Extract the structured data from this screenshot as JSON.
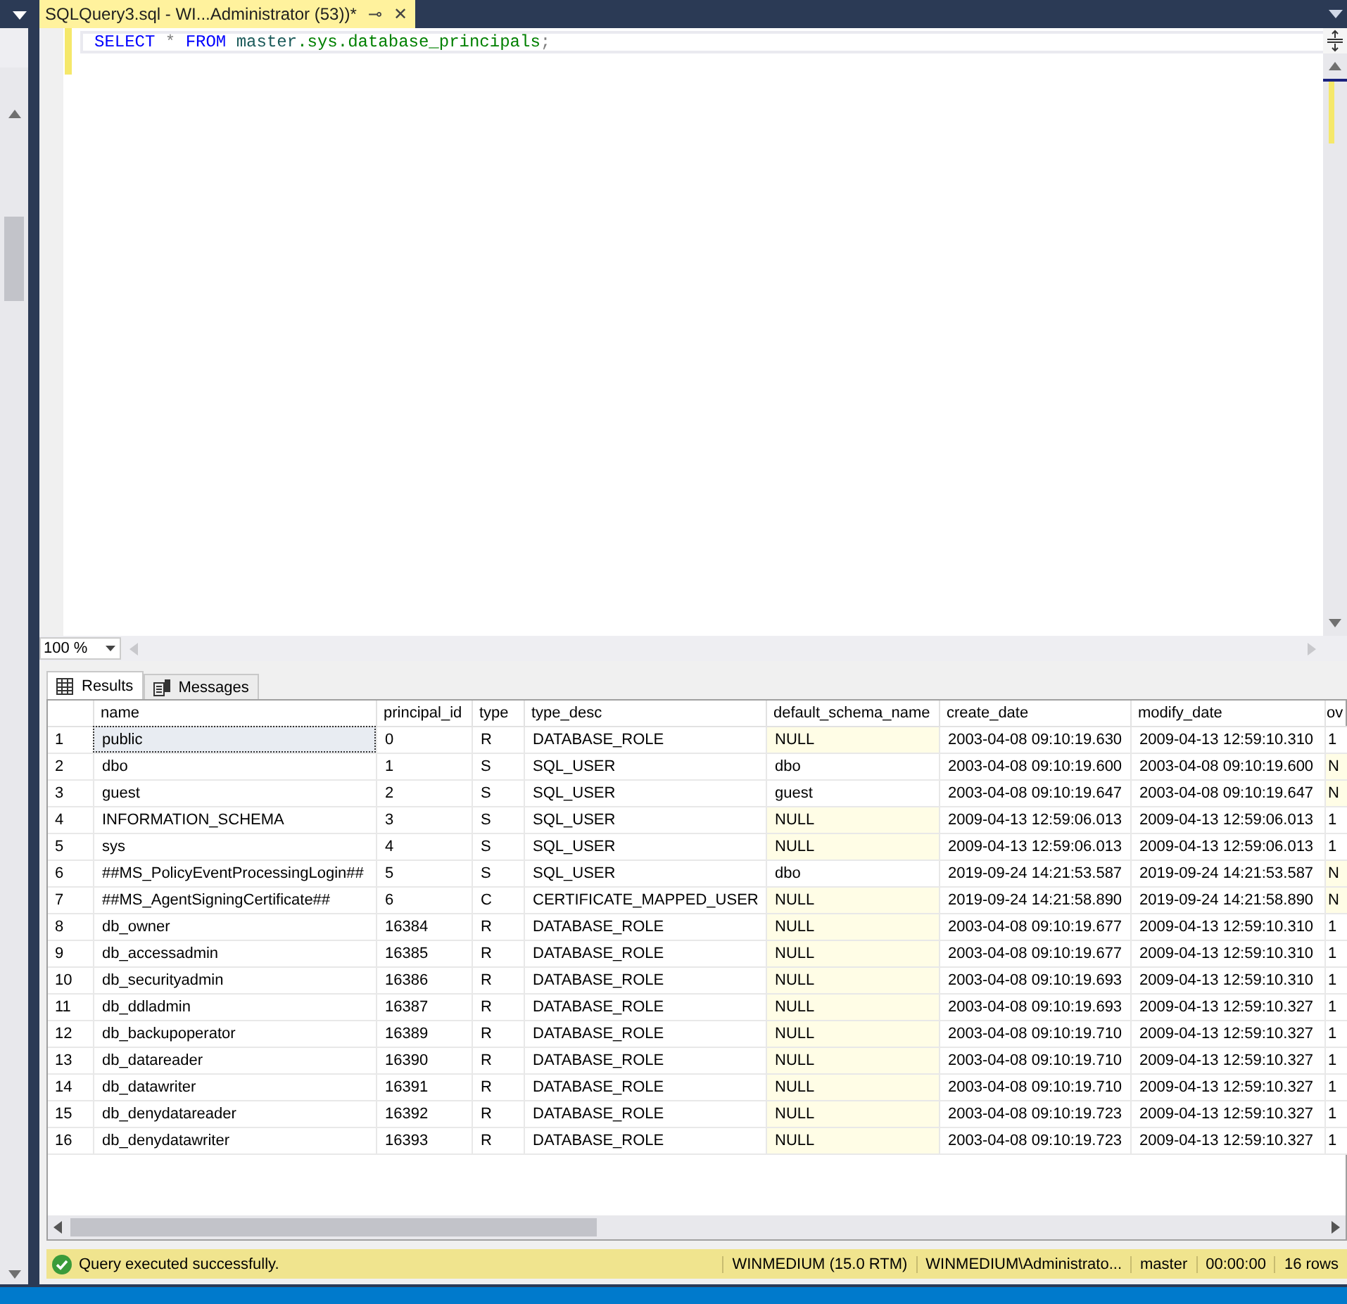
{
  "document_tab": {
    "title": "SQLQuery3.sql - WI...Administrator (53))*",
    "pin": "⊸",
    "close": "✕"
  },
  "editor": {
    "lines": [
      [
        {
          "kind": "keyword",
          "text": "SELECT"
        },
        {
          "kind": "operator",
          "text": "*"
        },
        {
          "kind": "keyword",
          "text": "FROM"
        },
        {
          "kind": "identifier",
          "text": "master"
        },
        {
          "kind": "system",
          "text": ".sys.database_principals"
        },
        {
          "kind": "operator",
          "text": ";"
        }
      ]
    ]
  },
  "zoom": {
    "value": "100 %"
  },
  "result_tabs": [
    {
      "label": "Results",
      "kind": "grid",
      "selected": true
    },
    {
      "label": "Messages",
      "kind": "messages",
      "selected": false
    }
  ],
  "grid": {
    "columns": [
      "name",
      "principal_id",
      "type",
      "type_desc",
      "default_schema_name",
      "create_date",
      "modify_date",
      "ov"
    ],
    "rows": [
      {
        "number": "1",
        "selected": true,
        "cells": [
          {
            "text": "public",
            "null": false
          },
          {
            "text": "0",
            "null": false
          },
          {
            "text": "R",
            "null": false
          },
          {
            "text": "DATABASE_ROLE",
            "null": false
          },
          {
            "text": "NULL",
            "null": true
          },
          {
            "text": "2003-04-08 09:10:19.630",
            "null": false
          },
          {
            "text": "2009-04-13 12:59:10.310",
            "null": false
          },
          {
            "text": "1",
            "null": false
          }
        ]
      },
      {
        "number": "2",
        "selected": false,
        "cells": [
          {
            "text": "dbo",
            "null": false
          },
          {
            "text": "1",
            "null": false
          },
          {
            "text": "S",
            "null": false
          },
          {
            "text": "SQL_USER",
            "null": false
          },
          {
            "text": "dbo",
            "null": false
          },
          {
            "text": "2003-04-08 09:10:19.600",
            "null": false
          },
          {
            "text": "2003-04-08 09:10:19.600",
            "null": false
          },
          {
            "text": "N",
            "null": true
          }
        ]
      },
      {
        "number": "3",
        "selected": false,
        "cells": [
          {
            "text": "guest",
            "null": false
          },
          {
            "text": "2",
            "null": false
          },
          {
            "text": "S",
            "null": false
          },
          {
            "text": "SQL_USER",
            "null": false
          },
          {
            "text": "guest",
            "null": false
          },
          {
            "text": "2003-04-08 09:10:19.647",
            "null": false
          },
          {
            "text": "2003-04-08 09:10:19.647",
            "null": false
          },
          {
            "text": "N",
            "null": true
          }
        ]
      },
      {
        "number": "4",
        "selected": false,
        "cells": [
          {
            "text": "INFORMATION_SCHEMA",
            "null": false
          },
          {
            "text": "3",
            "null": false
          },
          {
            "text": "S",
            "null": false
          },
          {
            "text": "SQL_USER",
            "null": false
          },
          {
            "text": "NULL",
            "null": true
          },
          {
            "text": "2009-04-13 12:59:06.013",
            "null": false
          },
          {
            "text": "2009-04-13 12:59:06.013",
            "null": false
          },
          {
            "text": "1",
            "null": false
          }
        ]
      },
      {
        "number": "5",
        "selected": false,
        "cells": [
          {
            "text": "sys",
            "null": false
          },
          {
            "text": "4",
            "null": false
          },
          {
            "text": "S",
            "null": false
          },
          {
            "text": "SQL_USER",
            "null": false
          },
          {
            "text": "NULL",
            "null": true
          },
          {
            "text": "2009-04-13 12:59:06.013",
            "null": false
          },
          {
            "text": "2009-04-13 12:59:06.013",
            "null": false
          },
          {
            "text": "1",
            "null": false
          }
        ]
      },
      {
        "number": "6",
        "selected": false,
        "cells": [
          {
            "text": "##MS_PolicyEventProcessingLogin##",
            "null": false
          },
          {
            "text": "5",
            "null": false
          },
          {
            "text": "S",
            "null": false
          },
          {
            "text": "SQL_USER",
            "null": false
          },
          {
            "text": "dbo",
            "null": false
          },
          {
            "text": "2019-09-24 14:21:53.587",
            "null": false
          },
          {
            "text": "2019-09-24 14:21:53.587",
            "null": false
          },
          {
            "text": "N",
            "null": true
          }
        ]
      },
      {
        "number": "7",
        "selected": false,
        "cells": [
          {
            "text": "##MS_AgentSigningCertificate##",
            "null": false
          },
          {
            "text": "6",
            "null": false
          },
          {
            "text": "C",
            "null": false
          },
          {
            "text": "CERTIFICATE_MAPPED_USER",
            "null": false
          },
          {
            "text": "NULL",
            "null": true
          },
          {
            "text": "2019-09-24 14:21:58.890",
            "null": false
          },
          {
            "text": "2019-09-24 14:21:58.890",
            "null": false
          },
          {
            "text": "N",
            "null": true
          }
        ]
      },
      {
        "number": "8",
        "selected": false,
        "cells": [
          {
            "text": "db_owner",
            "null": false
          },
          {
            "text": "16384",
            "null": false
          },
          {
            "text": "R",
            "null": false
          },
          {
            "text": "DATABASE_ROLE",
            "null": false
          },
          {
            "text": "NULL",
            "null": true
          },
          {
            "text": "2003-04-08 09:10:19.677",
            "null": false
          },
          {
            "text": "2009-04-13 12:59:10.310",
            "null": false
          },
          {
            "text": "1",
            "null": false
          }
        ]
      },
      {
        "number": "9",
        "selected": false,
        "cells": [
          {
            "text": "db_accessadmin",
            "null": false
          },
          {
            "text": "16385",
            "null": false
          },
          {
            "text": "R",
            "null": false
          },
          {
            "text": "DATABASE_ROLE",
            "null": false
          },
          {
            "text": "NULL",
            "null": true
          },
          {
            "text": "2003-04-08 09:10:19.677",
            "null": false
          },
          {
            "text": "2009-04-13 12:59:10.310",
            "null": false
          },
          {
            "text": "1",
            "null": false
          }
        ]
      },
      {
        "number": "10",
        "selected": false,
        "cells": [
          {
            "text": "db_securityadmin",
            "null": false
          },
          {
            "text": "16386",
            "null": false
          },
          {
            "text": "R",
            "null": false
          },
          {
            "text": "DATABASE_ROLE",
            "null": false
          },
          {
            "text": "NULL",
            "null": true
          },
          {
            "text": "2003-04-08 09:10:19.693",
            "null": false
          },
          {
            "text": "2009-04-13 12:59:10.310",
            "null": false
          },
          {
            "text": "1",
            "null": false
          }
        ]
      },
      {
        "number": "11",
        "selected": false,
        "cells": [
          {
            "text": "db_ddladmin",
            "null": false
          },
          {
            "text": "16387",
            "null": false
          },
          {
            "text": "R",
            "null": false
          },
          {
            "text": "DATABASE_ROLE",
            "null": false
          },
          {
            "text": "NULL",
            "null": true
          },
          {
            "text": "2003-04-08 09:10:19.693",
            "null": false
          },
          {
            "text": "2009-04-13 12:59:10.327",
            "null": false
          },
          {
            "text": "1",
            "null": false
          }
        ]
      },
      {
        "number": "12",
        "selected": false,
        "cells": [
          {
            "text": "db_backupoperator",
            "null": false
          },
          {
            "text": "16389",
            "null": false
          },
          {
            "text": "R",
            "null": false
          },
          {
            "text": "DATABASE_ROLE",
            "null": false
          },
          {
            "text": "NULL",
            "null": true
          },
          {
            "text": "2003-04-08 09:10:19.710",
            "null": false
          },
          {
            "text": "2009-04-13 12:59:10.327",
            "null": false
          },
          {
            "text": "1",
            "null": false
          }
        ]
      },
      {
        "number": "13",
        "selected": false,
        "cells": [
          {
            "text": "db_datareader",
            "null": false
          },
          {
            "text": "16390",
            "null": false
          },
          {
            "text": "R",
            "null": false
          },
          {
            "text": "DATABASE_ROLE",
            "null": false
          },
          {
            "text": "NULL",
            "null": true
          },
          {
            "text": "2003-04-08 09:10:19.710",
            "null": false
          },
          {
            "text": "2009-04-13 12:59:10.327",
            "null": false
          },
          {
            "text": "1",
            "null": false
          }
        ]
      },
      {
        "number": "14",
        "selected": false,
        "cells": [
          {
            "text": "db_datawriter",
            "null": false
          },
          {
            "text": "16391",
            "null": false
          },
          {
            "text": "R",
            "null": false
          },
          {
            "text": "DATABASE_ROLE",
            "null": false
          },
          {
            "text": "NULL",
            "null": true
          },
          {
            "text": "2003-04-08 09:10:19.710",
            "null": false
          },
          {
            "text": "2009-04-13 12:59:10.327",
            "null": false
          },
          {
            "text": "1",
            "null": false
          }
        ]
      },
      {
        "number": "15",
        "selected": false,
        "cells": [
          {
            "text": "db_denydatareader",
            "null": false
          },
          {
            "text": "16392",
            "null": false
          },
          {
            "text": "R",
            "null": false
          },
          {
            "text": "DATABASE_ROLE",
            "null": false
          },
          {
            "text": "NULL",
            "null": true
          },
          {
            "text": "2003-04-08 09:10:19.723",
            "null": false
          },
          {
            "text": "2009-04-13 12:59:10.327",
            "null": false
          },
          {
            "text": "1",
            "null": false
          }
        ]
      },
      {
        "number": "16",
        "selected": false,
        "cells": [
          {
            "text": "db_denydatawriter",
            "null": false
          },
          {
            "text": "16393",
            "null": false
          },
          {
            "text": "R",
            "null": false
          },
          {
            "text": "DATABASE_ROLE",
            "null": false
          },
          {
            "text": "NULL",
            "null": true
          },
          {
            "text": "2003-04-08 09:10:19.723",
            "null": false
          },
          {
            "text": "2009-04-13 12:59:10.327",
            "null": false
          },
          {
            "text": "1",
            "null": false
          }
        ]
      }
    ]
  },
  "status_bar": {
    "message": "Query executed successfully.",
    "segments": [
      "WINMEDIUM (15.0 RTM)",
      "WINMEDIUM\\Administrato...",
      "master",
      "00:00:00",
      "16 rows"
    ]
  }
}
